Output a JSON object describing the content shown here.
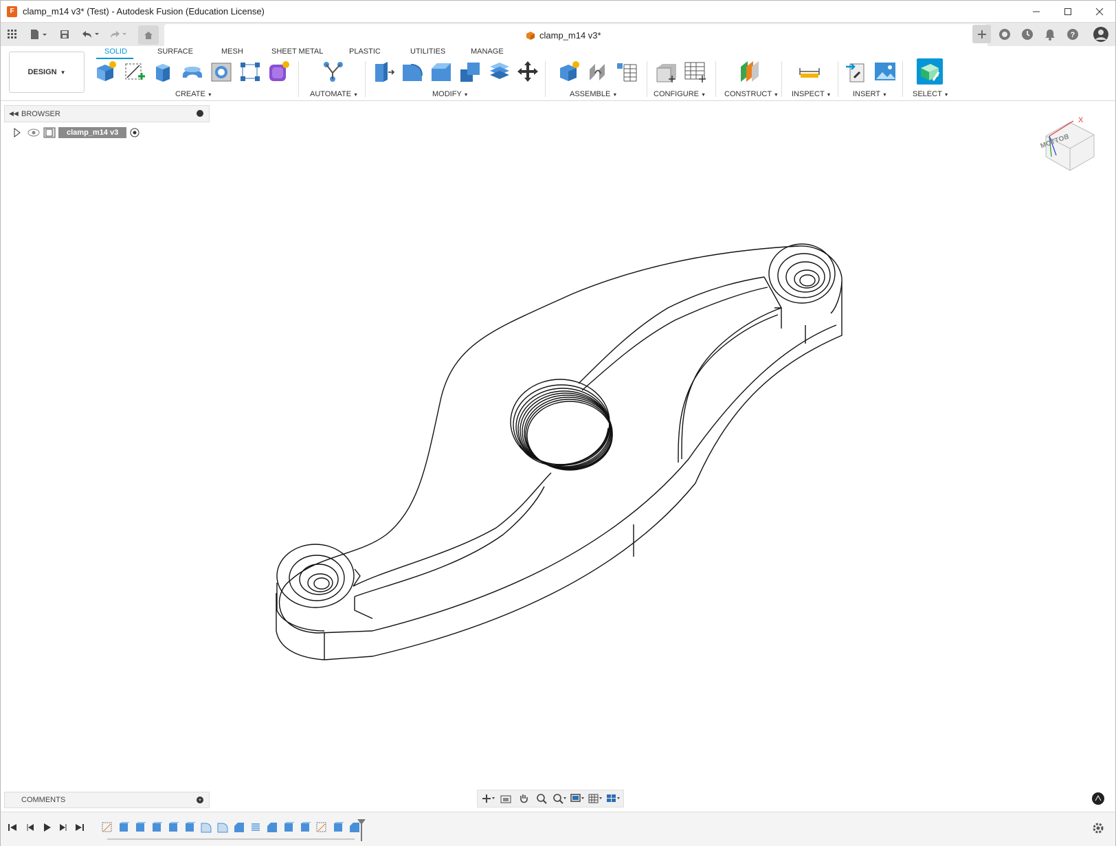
{
  "window": {
    "title": "clamp_m14 v3* (Test) - Autodesk Fusion (Education License)",
    "app_icon": "F",
    "controls": [
      "minimize-icon",
      "maximize-icon",
      "close-icon"
    ]
  },
  "tabbar": {
    "document_tab": "clamp_m14 v3*",
    "quick_access_icons": [
      "grid-icon",
      "file-icon",
      "save-icon",
      "undo-icon",
      "redo-icon",
      "home-icon"
    ],
    "right_icons": [
      "new-tab-icon",
      "extensions-icon",
      "job-status-icon",
      "notifications-icon",
      "help-icon",
      "avatar"
    ]
  },
  "ribbon": {
    "workspace": "DESIGN",
    "tabs": [
      "SOLID",
      "SURFACE",
      "MESH",
      "SHEET METAL",
      "PLASTIC",
      "UTILITIES",
      "MANAGE"
    ],
    "active_tab": "SOLID",
    "groups": [
      "CREATE",
      "AUTOMATE",
      "MODIFY",
      "ASSEMBLE",
      "CONFIGURE",
      "CONSTRUCT",
      "INSPECT",
      "INSERT",
      "SELECT"
    ],
    "accent": "#0696d7"
  },
  "browser": {
    "title": "BROWSER",
    "root_component": "clamp_m14 v3"
  },
  "comments": {
    "title": "COMMENTS"
  },
  "viewcube": {
    "face_label": "BOTTOM",
    "axis_label": "X"
  },
  "colors": {
    "brand": "#e8661c",
    "accent": "#0696d7"
  }
}
